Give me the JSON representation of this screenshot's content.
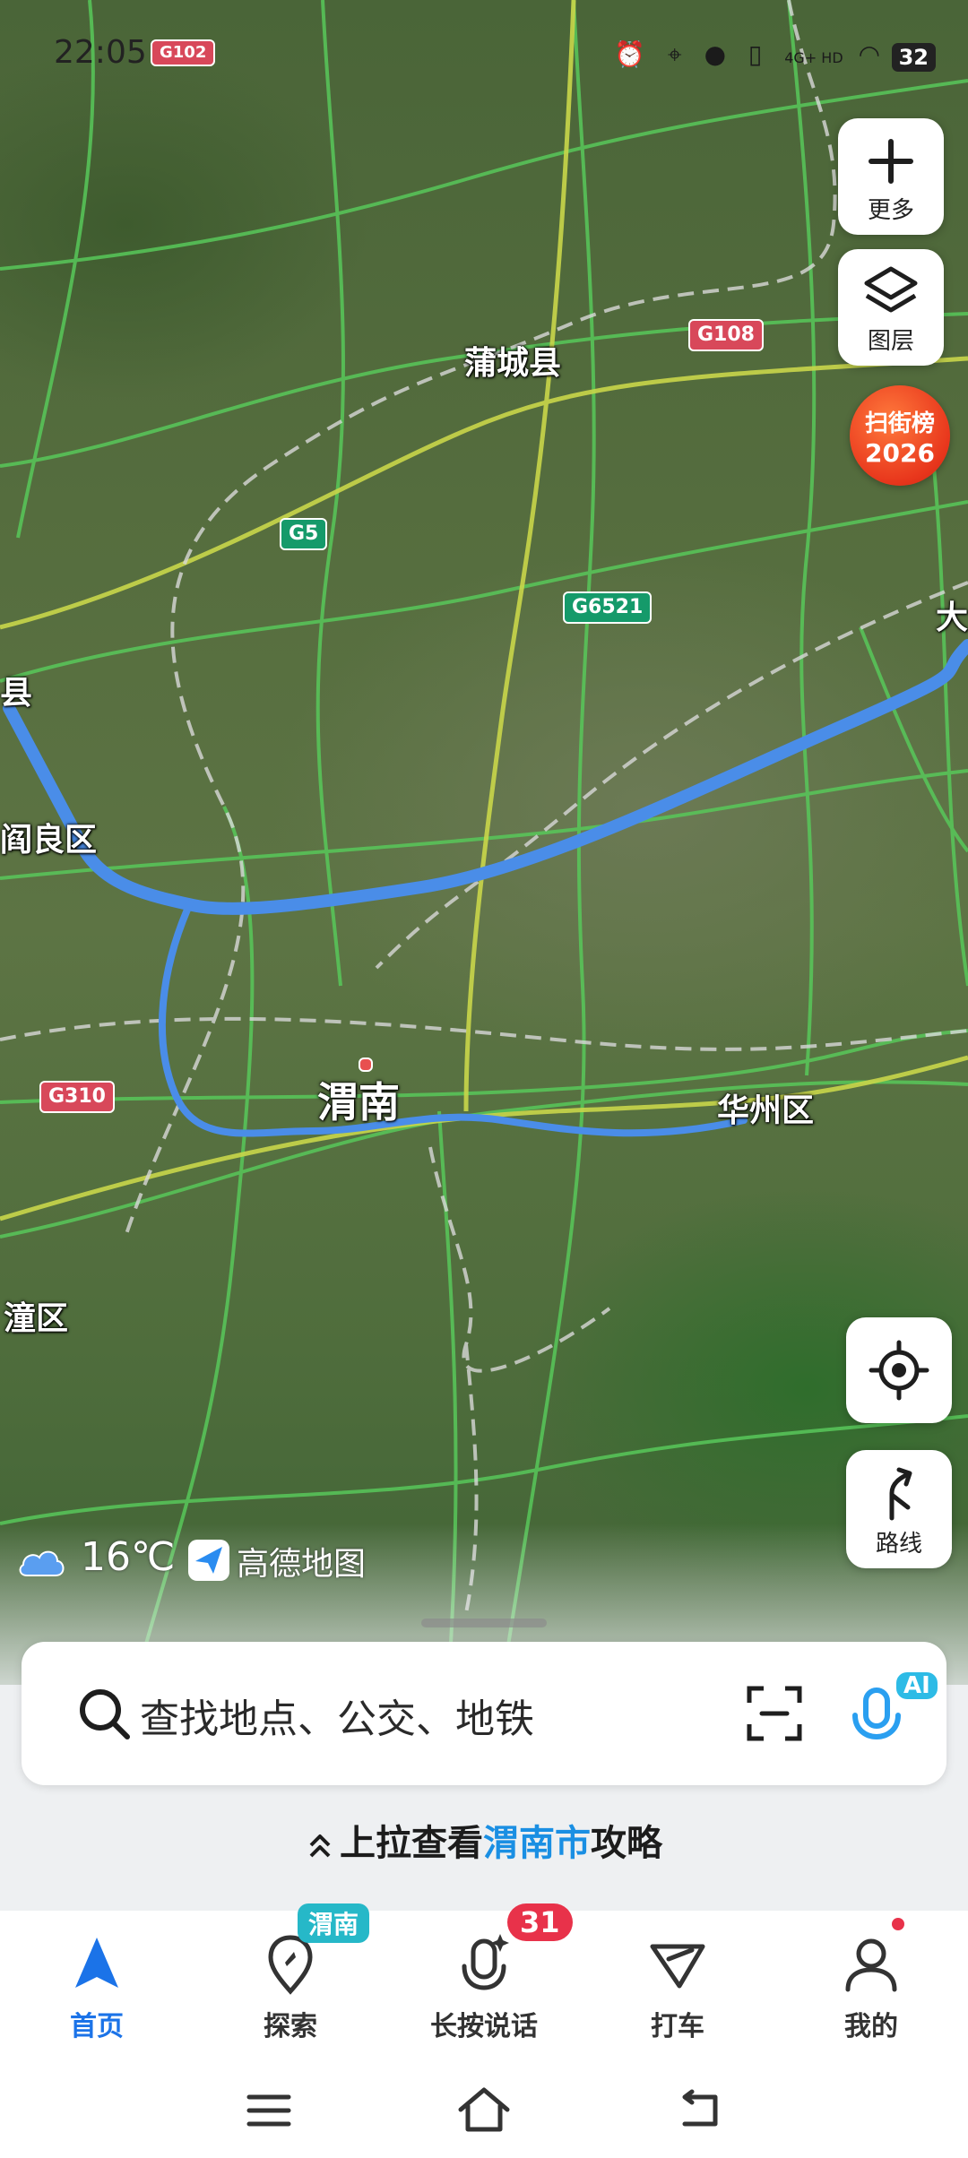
{
  "status_bar": {
    "time": "22:05",
    "network": "4G+ HD",
    "battery": "32",
    "icons": [
      "alarm-icon",
      "location-icon",
      "mic-icon",
      "vibrate-icon",
      "signal-icon",
      "wifi-icon"
    ]
  },
  "map": {
    "places": [
      {
        "name": "蒲城县",
        "size": "mid"
      },
      {
        "name": "渭南",
        "size": "big"
      },
      {
        "name": "华州区",
        "size": "mid"
      },
      {
        "name": "阎良区",
        "size": "mid"
      },
      {
        "name": "潼区",
        "size": "mid"
      },
      {
        "name": "县",
        "size": "mid"
      },
      {
        "name": "大",
        "size": "mid"
      }
    ],
    "road_shields": [
      {
        "code": "G108",
        "color": "red"
      },
      {
        "code": "G5",
        "color": "green"
      },
      {
        "code": "G6521",
        "color": "green"
      },
      {
        "code": "G310",
        "color": "red"
      },
      {
        "code": "G102",
        "color": "red"
      }
    ],
    "route_color": "#4a8de8"
  },
  "right_buttons": {
    "more": "更多",
    "layers": "图层",
    "rank_line1": "扫街榜",
    "rank_line2": "2026",
    "route": "路线"
  },
  "weather": {
    "temperature": "16℃",
    "brand": "高德地图"
  },
  "search": {
    "placeholder": "查找地点、公交、地铁",
    "ai_badge": "AI"
  },
  "pullup": {
    "prefix": "上拉查看",
    "city": "渭南市",
    "suffix": "攻略"
  },
  "tabs": [
    {
      "label": "首页",
      "icon": "home-arrow-icon",
      "active": true
    },
    {
      "label": "探索",
      "icon": "explore-pin-icon",
      "badge": "渭南"
    },
    {
      "label": "长按说话",
      "icon": "mic-sparkle-icon",
      "badge": "31"
    },
    {
      "label": "打车",
      "icon": "taxi-icon"
    },
    {
      "label": "我的",
      "icon": "profile-icon",
      "dot": true
    }
  ],
  "colors": {
    "accent": "#1b73e8",
    "badge_red": "#e8324a",
    "badge_teal": "#26b8c8"
  }
}
